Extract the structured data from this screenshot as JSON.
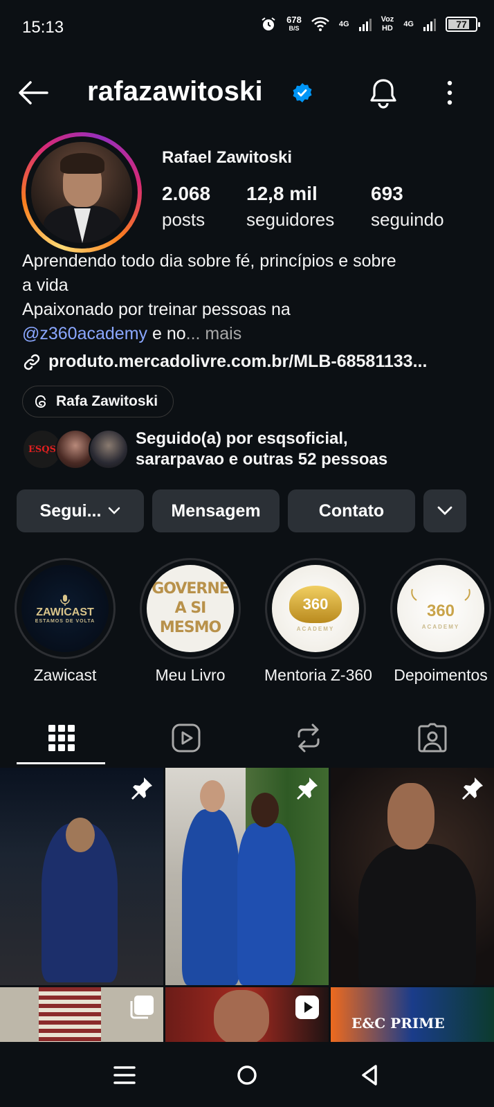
{
  "status_bar": {
    "time": "15:13",
    "speed_value": "678",
    "speed_unit": "B/S",
    "net1": "4G",
    "voz": "Voz",
    "hd": "HD",
    "net2": "4G",
    "battery": "77"
  },
  "header": {
    "username": "rafazawitoski",
    "icons": [
      "back-arrow-icon",
      "verified-badge-icon",
      "bell-icon",
      "more-vertical-icon"
    ]
  },
  "profile": {
    "full_name": "Rafael Zawitoski",
    "stats": [
      {
        "value": "2.068",
        "label": "posts"
      },
      {
        "value": "12,8 mil",
        "label": "seguidores"
      },
      {
        "value": "693",
        "label": "seguindo"
      }
    ],
    "bio": {
      "line1": "Aprendendo todo dia sobre fé, princípios e sobre",
      "line2": "a vida",
      "line3": "Apaixonado por treinar pessoas na",
      "mention": "@z360academy",
      "after_mention": " e no",
      "ellipsis_more": "... mais"
    },
    "link": "produto.mercadolivre.com.br/MLB-68581133...",
    "threads_label": "Rafa Zawitoski",
    "followed_by": {
      "line1": "Seguido(a) por esqsoficial,",
      "line2": "sararpavao e outras 52 pessoas",
      "mini_avatar_1_text": "ESQS"
    }
  },
  "actions": {
    "follow": "Segui...",
    "message": "Mensagem",
    "contact": "Contato"
  },
  "highlights": [
    {
      "label": "Zawicast",
      "cover_title": "ZAWICAST",
      "cover_sub": "ESTAMOS DE VOLTA"
    },
    {
      "label": "Meu Livro",
      "cover_line1": "GOVERNE",
      "cover_line2": "A SI MESMO"
    },
    {
      "label": "Mentoria Z-360",
      "cover_title": "360",
      "cover_sub": "ACADEMY"
    },
    {
      "label": "Depoimentos",
      "cover_title": "360",
      "cover_sub": "ACADEMY"
    }
  ],
  "tabs": [
    "grid-icon",
    "reels-icon",
    "reposts-icon",
    "tagged-icon"
  ],
  "grid": {
    "bottom_caption": "E&C PRIME"
  },
  "colors": {
    "background": "#0c1014",
    "button": "#2b3036",
    "mention": "#8aa7ff",
    "verified": "#0095f6"
  }
}
